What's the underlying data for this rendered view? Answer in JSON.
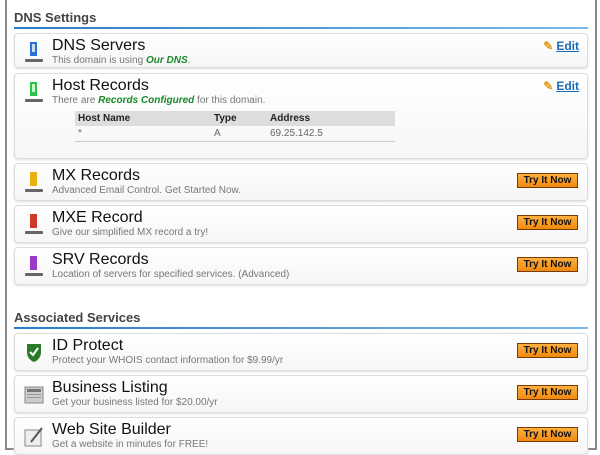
{
  "dns_settings": {
    "heading": "DNS Settings",
    "dns_servers": {
      "title": "DNS Servers",
      "sub_pre": "This domain is using ",
      "sub_hl": "Our DNS",
      "sub_post": ".",
      "edit": "Edit",
      "icon": "server-icon",
      "icon_color": "#2a6fd6"
    },
    "host_records": {
      "title": "Host Records",
      "sub_pre": "There are ",
      "sub_hl": "Records Configured",
      "sub_post": " for this domain.",
      "edit": "Edit",
      "icon": "server-icon",
      "icon_color": "#2ac24a",
      "columns": [
        "Host Name",
        "Type",
        "Address"
      ],
      "rows": [
        [
          "*",
          "A",
          "69.25.142.5"
        ]
      ]
    },
    "mx": {
      "title": "MX Records",
      "sub": "Advanced Email Control. Get Started Now.",
      "button": "Try It Now",
      "icon_color": "#e8b010"
    },
    "mxe": {
      "title": "MXE Record",
      "sub": "Give our simplified MX record a try!",
      "button": "Try It Now",
      "icon_color": "#d03a2a"
    },
    "srv": {
      "title": "SRV Records",
      "sub": "Location of servers for specified services. (Advanced)",
      "button": "Try It Now",
      "icon_color": "#9a3ac8"
    }
  },
  "associated": {
    "heading": "Associated Services",
    "id_protect": {
      "title": "ID Protect",
      "sub": "Protect your WHOIS contact information for $9.99/yr",
      "button": "Try It Now"
    },
    "business": {
      "title": "Business Listing",
      "sub": "Get your business listed for $20.00/yr",
      "button": "Try It Now"
    },
    "website": {
      "title": "Web Site Builder",
      "sub": "Get a website in minutes for FREE!",
      "button": "Try It Now"
    }
  }
}
